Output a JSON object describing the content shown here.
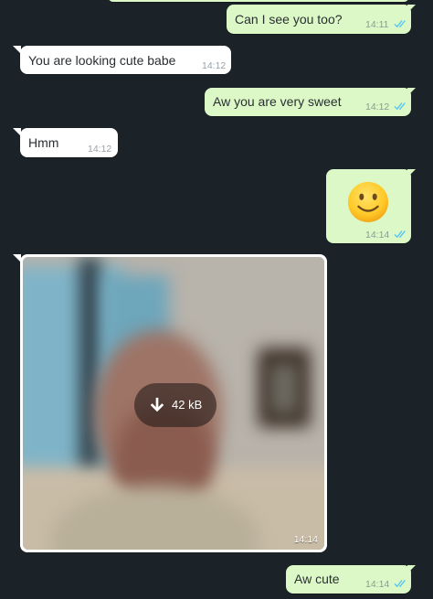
{
  "colors": {
    "background": "#1b2328",
    "outgoing_bubble": "#dcf8c6",
    "incoming_bubble": "#ffffff",
    "read_ticks": "#4fc3f7"
  },
  "messages": [
    {
      "direction": "outgoing",
      "text": "Can I see you too?",
      "time": "14:11",
      "status": "read-double-tick-icon"
    },
    {
      "direction": "incoming",
      "text": "You are looking cute babe",
      "time": "14:12"
    },
    {
      "direction": "outgoing",
      "text": "Aw you are very sweet",
      "time": "14:12",
      "status": "read-double-tick-icon"
    },
    {
      "direction": "incoming",
      "text": "Hmm",
      "time": "14:12"
    },
    {
      "direction": "outgoing",
      "emoji": "🙂",
      "time": "14:14",
      "status": "read-double-tick-icon"
    },
    {
      "direction": "incoming",
      "type": "photo",
      "download_size": "42 kB",
      "time": "14:14",
      "icon": "download-arrow-icon"
    },
    {
      "direction": "outgoing",
      "text": "Aw cute",
      "time": "14:14",
      "status": "read-double-tick-icon"
    }
  ]
}
